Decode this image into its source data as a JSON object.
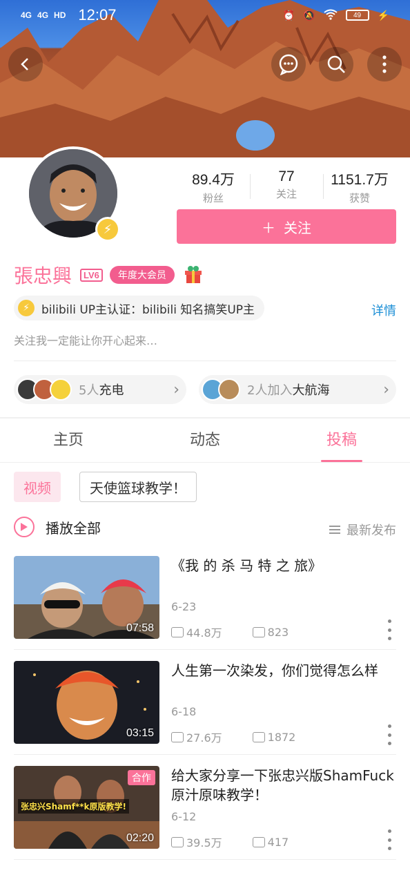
{
  "status_bar": {
    "signal1": "4G",
    "signal2": "4G",
    "hd": "HD",
    "time": "12:07",
    "battery": "49"
  },
  "header": {
    "back_icon": "back-arrow-icon",
    "message_icon": "chat-bubble-icon",
    "search_icon": "search-icon",
    "more_icon": "more-vertical-icon"
  },
  "profile": {
    "stats": [
      {
        "value": "89.4万",
        "label": "粉丝"
      },
      {
        "value": "77",
        "label": "关注"
      },
      {
        "value": "1151.7万",
        "label": "获赞"
      }
    ],
    "follow_label": "关注",
    "follow_plus": "＋",
    "username": "張忠興",
    "level": "LV6",
    "vip_label": "年度大会员",
    "certification": "bilibili UP主认证：bilibili 知名搞笑UP主",
    "detail_link": "详情",
    "signature": "关注我一定能让你开心起来…",
    "charge": {
      "prefix": "5人",
      "label": "充电"
    },
    "voyage": {
      "prefix": "2人加入",
      "label": "大航海"
    }
  },
  "tabs": [
    "主页",
    "动态",
    "投稿"
  ],
  "active_tab": "投稿",
  "filters": {
    "type_chip": "视频",
    "series_chip": "天使篮球教学！"
  },
  "list_header": {
    "play_all": "播放全部",
    "sort": "最新发布"
  },
  "videos": [
    {
      "title": "《我 的 杀 马 特 之 旅》",
      "date": "6-23",
      "duration": "07:58",
      "views": "44.8万",
      "danmaku": "823",
      "badge": ""
    },
    {
      "title": "人生第一次染发，你们觉得怎么样",
      "date": "6-18",
      "duration": "03:15",
      "views": "27.6万",
      "danmaku": "1872",
      "badge": ""
    },
    {
      "title": "给大家分享一下张忠兴版ShamFuck原汁原味教学！",
      "date": "6-12",
      "duration": "02:20",
      "views": "39.5万",
      "danmaku": "417",
      "badge": "合作",
      "thumb_caption": "张忠兴Shamf**k原版教学!"
    }
  ],
  "colors": {
    "accent": "#fb7299",
    "link": "#1c8fd6",
    "bolt": "#f7c93c"
  }
}
